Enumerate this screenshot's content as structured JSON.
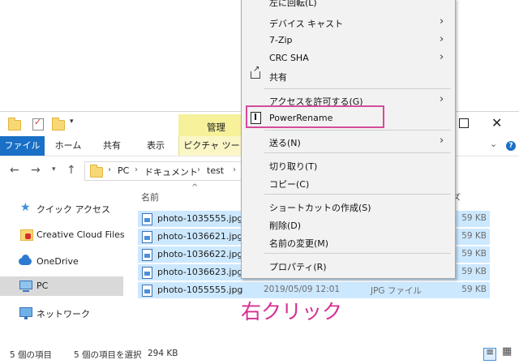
{
  "window": {
    "manage_tab": "管理",
    "ribbon_tabs": [
      "ファイル",
      "ホーム",
      "共有",
      "表示",
      "ピクチャ ツール"
    ]
  },
  "nav": {
    "breadcrumb": [
      "PC",
      "ドキュメント",
      "test"
    ]
  },
  "sidebar": {
    "items": [
      {
        "label": "クイック アクセス",
        "icon": "star-icon"
      },
      {
        "label": "Creative Cloud Files",
        "icon": "creative-cloud-folder-icon"
      },
      {
        "label": "OneDrive",
        "icon": "onedrive-cloud-icon"
      },
      {
        "label": "PC",
        "icon": "pc-icon",
        "selected": true
      },
      {
        "label": "ネットワーク",
        "icon": "network-icon"
      }
    ]
  },
  "filelist": {
    "col_name": "名前",
    "col_size": "ズ",
    "files": [
      {
        "name": "photo-1035555.jpg",
        "date": "",
        "type": "",
        "size": "59 KB"
      },
      {
        "name": "photo-1036621.jpg",
        "date": "",
        "type": "",
        "size": "59 KB"
      },
      {
        "name": "photo-1036622.jpg",
        "date": "",
        "type": "",
        "size": "59 KB"
      },
      {
        "name": "photo-1036623.jpg",
        "date": "",
        "type": "",
        "size": "59 KB"
      },
      {
        "name": "photo-1055555.jpg",
        "date": "2019/05/09 12:01",
        "type": "JPG ファイル",
        "size": "59 KB"
      }
    ]
  },
  "status": {
    "item_count": "5 個の項目",
    "selected": "5 個の項目を選択",
    "size": "294 KB"
  },
  "context_menu": {
    "items": [
      {
        "label": "左に回転(L)",
        "submenu": false
      },
      {
        "label": "デバイス キャスト",
        "submenu": true
      },
      {
        "label": "7-Zip",
        "submenu": true
      },
      {
        "label": "CRC SHA",
        "submenu": true
      },
      {
        "label": "共有",
        "submenu": false,
        "icon": "share-icon"
      },
      {
        "label": "アクセスを許可する(G)",
        "submenu": true
      },
      {
        "label": "PowerRename",
        "submenu": false,
        "icon": "powerrename-icon",
        "highlighted": true
      },
      {
        "label": "送る(N)",
        "submenu": true
      },
      {
        "label": "切り取り(T)",
        "submenu": false
      },
      {
        "label": "コピー(C)",
        "submenu": false
      },
      {
        "label": "ショートカットの作成(S)",
        "submenu": false
      },
      {
        "label": "削除(D)",
        "submenu": false
      },
      {
        "label": "名前の変更(M)",
        "submenu": false
      },
      {
        "label": "プロパティ(R)",
        "submenu": false
      }
    ]
  },
  "annotation": {
    "text": "右クリック",
    "color": "#d52f93"
  },
  "colors": {
    "accent": "#1a6fc6",
    "selection": "#cce8ff",
    "manage_tab": "#f6f19a",
    "highlight_border": "#d64b9c"
  }
}
